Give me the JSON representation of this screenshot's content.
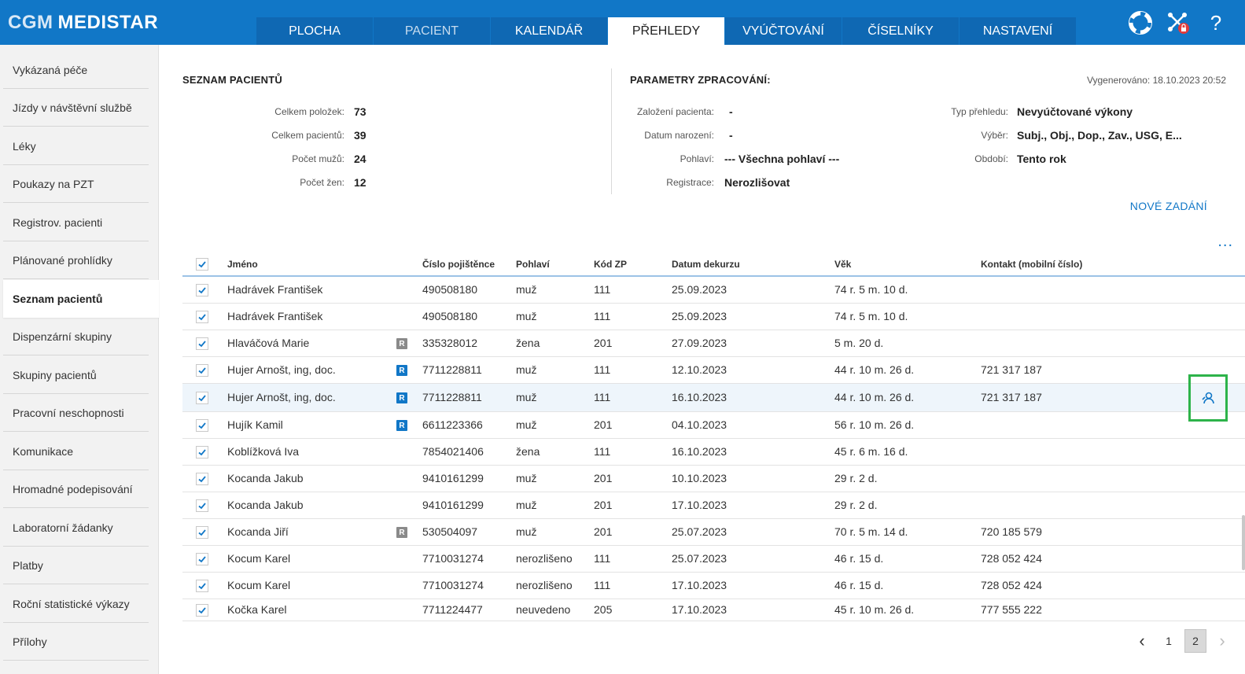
{
  "app": {
    "logo_prefix": "CGM",
    "logo_name": "MEDISTAR"
  },
  "nav": {
    "tabs": [
      {
        "label": "PLOCHA"
      },
      {
        "label": "PACIENT"
      },
      {
        "label": "KALENDÁŘ"
      },
      {
        "label": "PŘEHLEDY"
      },
      {
        "label": "VYÚČTOVÁNÍ"
      },
      {
        "label": "ČÍSELNÍKY"
      },
      {
        "label": "NASTAVENÍ"
      }
    ],
    "active_tab": "PŘEHLEDY",
    "icons": [
      "lifebuoy-icon",
      "disconnect-icon",
      "help-icon"
    ],
    "help_glyph": "?"
  },
  "sidebar": {
    "items": [
      {
        "label": "Vykázaná péče"
      },
      {
        "label": "Jízdy v návštěvní službě"
      },
      {
        "label": "Léky"
      },
      {
        "label": "Poukazy na PZT"
      },
      {
        "label": "Registrov. pacienti"
      },
      {
        "label": "Plánované prohlídky"
      },
      {
        "label": "Seznam pacientů"
      },
      {
        "label": "Dispenzární skupiny"
      },
      {
        "label": "Skupiny pacientů"
      },
      {
        "label": "Pracovní neschopnosti"
      },
      {
        "label": "Komunikace"
      },
      {
        "label": "Hromadné podepisování"
      },
      {
        "label": "Laboratorní žádanky"
      },
      {
        "label": "Platby"
      },
      {
        "label": "Roční statistické výkazy"
      },
      {
        "label": "Přílohy"
      }
    ],
    "active_item": "Seznam pacientů"
  },
  "summary": {
    "title": "SEZNAM PACIENTŮ",
    "rows": [
      {
        "label": "Celkem položek:",
        "value": "73"
      },
      {
        "label": "Celkem pacientů:",
        "value": "39"
      },
      {
        "label": "Počet mužů:",
        "value": "24"
      },
      {
        "label": "Počet žen:",
        "value": "12"
      }
    ]
  },
  "params": {
    "title": "PARAMETRY ZPRACOVÁNÍ:",
    "generated": "Vygenerováno: 18.10.2023 20:52",
    "left": [
      {
        "label": "Založení pacienta:",
        "value": "-"
      },
      {
        "label": "Datum narození:",
        "value": "-"
      },
      {
        "label": "Pohlaví:",
        "value": "--- Všechna pohlaví ---"
      },
      {
        "label": "Registrace:",
        "value": "Nerozlišovat"
      }
    ],
    "right": [
      {
        "label": "Typ přehledu:",
        "value": "Nevyúčtované výkony"
      },
      {
        "label": "Výběr:",
        "value": "Subj., Obj., Dop., Zav., USG, E..."
      },
      {
        "label": "Období:",
        "value": "Tento rok"
      }
    ],
    "new_entry": "NOVÉ ZADÁNÍ",
    "more": "..."
  },
  "table": {
    "columns": {
      "name": "Jméno",
      "insurance_no": "Číslo pojištěnce",
      "sex": "Pohlaví",
      "insurer": "Kód ZP",
      "date": "Datum dekurzu",
      "age": "Věk",
      "contact": "Kontakt (mobilní číslo)"
    },
    "rows": [
      {
        "name": "Hadrávek František",
        "badge": "",
        "insurance_no": "490508180",
        "sex": "muž",
        "insurer": "111",
        "date": "25.09.2023",
        "age": "74 r. 5 m. 10 d.",
        "contact": ""
      },
      {
        "name": "Hadrávek František",
        "badge": "",
        "insurance_no": "490508180",
        "sex": "muž",
        "insurer": "111",
        "date": "25.09.2023",
        "age": "74 r. 5 m. 10 d.",
        "contact": ""
      },
      {
        "name": "Hlaváčová Marie",
        "badge": "R",
        "badge_color": "gray",
        "insurance_no": "335328012",
        "sex": "žena",
        "insurer": "201",
        "date": "27.09.2023",
        "age": "5 m. 20 d.",
        "contact": ""
      },
      {
        "name": "Hujer Arnošt, ing, doc.",
        "badge": "R",
        "badge_color": "blue",
        "insurance_no": "7711228811",
        "sex": "muž",
        "insurer": "111",
        "date": "12.10.2023",
        "age": "44 r. 10 m. 26 d.",
        "contact": "721 317 187"
      },
      {
        "name": "Hujer Arnošt, ing, doc.",
        "badge": "R",
        "badge_color": "blue",
        "insurance_no": "7711228811",
        "sex": "muž",
        "insurer": "111",
        "date": "16.10.2023",
        "age": "44 r. 10 m. 26 d.",
        "contact": "721 317 187",
        "highlighted": true
      },
      {
        "name": "Hujík Kamil",
        "badge": "R",
        "badge_color": "blue",
        "insurance_no": "6611223366",
        "sex": "muž",
        "insurer": "201",
        "date": "04.10.2023",
        "age": "56 r. 10 m. 26 d.",
        "contact": ""
      },
      {
        "name": "Koblížková Iva",
        "badge": "",
        "insurance_no": "7854021406",
        "sex": "žena",
        "insurer": "111",
        "date": "16.10.2023",
        "age": "45 r. 6 m. 16 d.",
        "contact": ""
      },
      {
        "name": "Kocanda Jakub",
        "badge": "",
        "insurance_no": "9410161299",
        "sex": "muž",
        "insurer": "201",
        "date": "10.10.2023",
        "age": "29 r. 2 d.",
        "contact": ""
      },
      {
        "name": "Kocanda Jakub",
        "badge": "",
        "insurance_no": "9410161299",
        "sex": "muž",
        "insurer": "201",
        "date": "17.10.2023",
        "age": "29 r. 2 d.",
        "contact": ""
      },
      {
        "name": "Kocanda Jiří",
        "badge": "R",
        "badge_color": "gray",
        "insurance_no": "530504097",
        "sex": "muž",
        "insurer": "201",
        "date": "25.07.2023",
        "age": "70 r. 5 m. 14 d.",
        "contact": "720 185 579"
      },
      {
        "name": "Kocum Karel",
        "badge": "",
        "insurance_no": "7710031274",
        "sex": "nerozlišeno",
        "insurer": "111",
        "date": "25.07.2023",
        "age": "46 r. 15 d.",
        "contact": "728 052 424"
      },
      {
        "name": "Kocum Karel",
        "badge": "",
        "insurance_no": "7710031274",
        "sex": "nerozlišeno",
        "insurer": "111",
        "date": "17.10.2023",
        "age": "46 r. 15 d.",
        "contact": "728 052 424"
      },
      {
        "name": "Kočka Karel",
        "badge": "",
        "insurance_no": "7711224477",
        "sex": "neuvedeno",
        "insurer": "205",
        "date": "17.10.2023",
        "age": "45 r. 10 m. 26 d.",
        "contact": "777 555 222"
      }
    ]
  },
  "pagination": {
    "pages": [
      "1",
      "2"
    ],
    "current": "2"
  },
  "colors": {
    "header": "#1177c7",
    "accent": "#1177c7",
    "highlight_box": "#2db34a"
  }
}
